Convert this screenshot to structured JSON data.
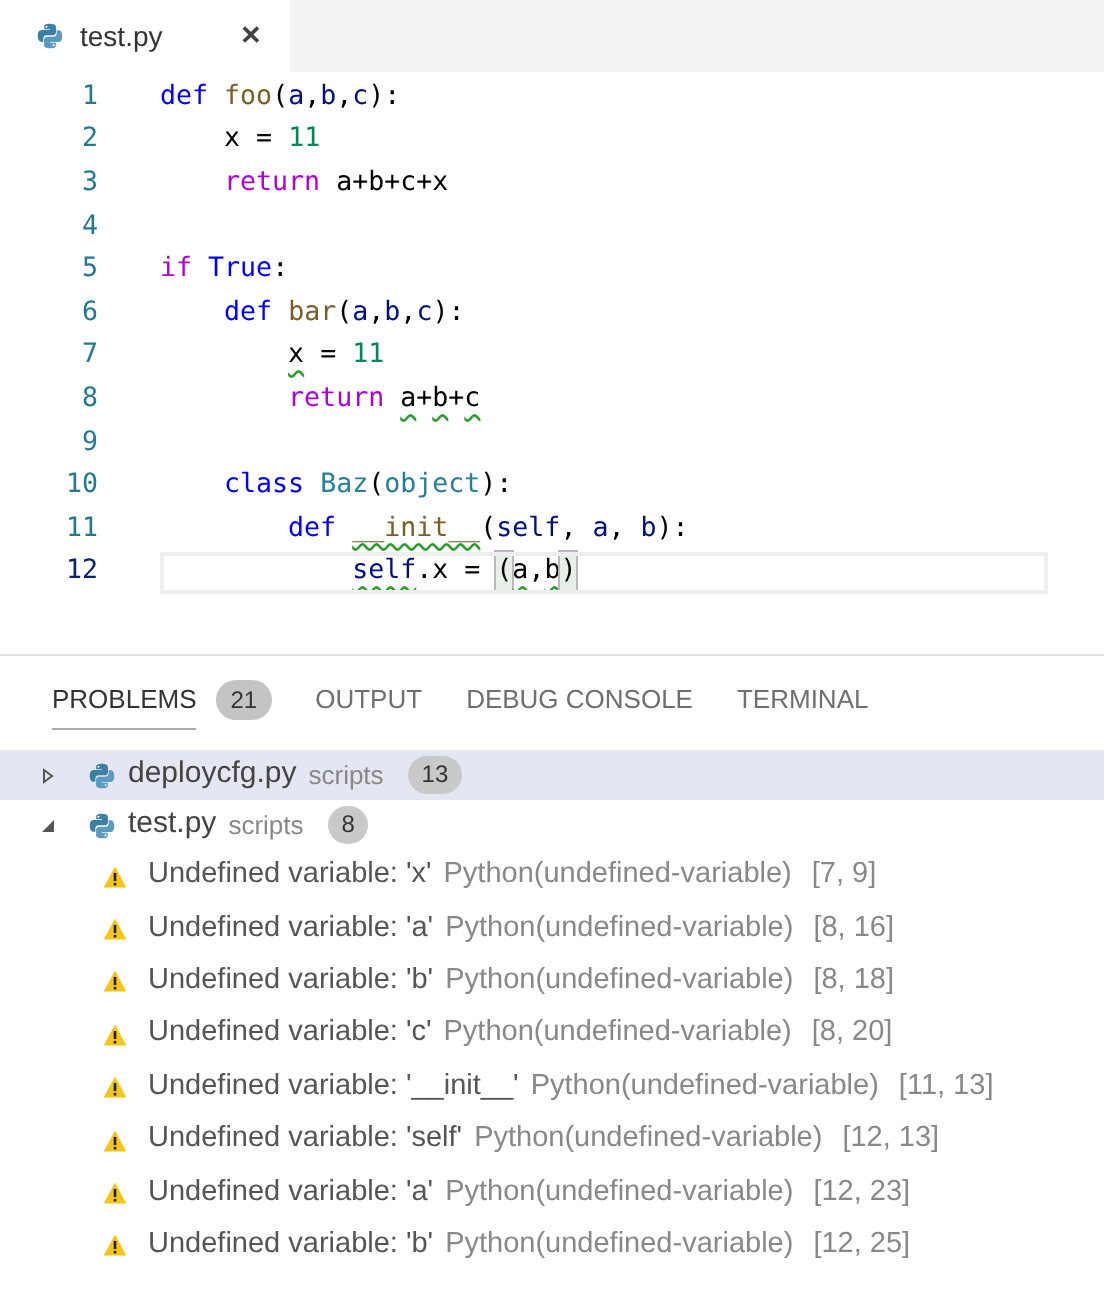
{
  "editor_tabs": [
    {
      "label": "test.py",
      "selected": true,
      "close": "✕"
    }
  ],
  "code_lines": [
    {
      "number": "1",
      "current": false,
      "tokens": [
        {
          "t": "def ",
          "kind": "kw",
          "squiggle": false
        },
        {
          "t": "foo",
          "kind": "fn",
          "squiggle": false
        },
        {
          "t": "(",
          "kind": "plain",
          "squiggle": false
        },
        {
          "t": "a",
          "kind": "param",
          "squiggle": false
        },
        {
          "t": ",",
          "kind": "plain",
          "squiggle": false
        },
        {
          "t": "b",
          "kind": "param",
          "squiggle": false
        },
        {
          "t": ",",
          "kind": "plain",
          "squiggle": false
        },
        {
          "t": "c",
          "kind": "param",
          "squiggle": false
        },
        {
          "t": "):",
          "kind": "plain",
          "squiggle": false
        }
      ]
    },
    {
      "number": "2",
      "current": false,
      "tokens": [
        {
          "t": "    x = ",
          "kind": "plain",
          "squiggle": false
        },
        {
          "t": "11",
          "kind": "num",
          "squiggle": false
        }
      ]
    },
    {
      "number": "3",
      "current": false,
      "tokens": [
        {
          "t": "    return",
          "kind": "ctrl",
          "squiggle": false
        },
        {
          "t": " a+b+c+x",
          "kind": "plain",
          "squiggle": false
        }
      ]
    },
    {
      "number": "4",
      "current": false
    },
    {
      "number": "5",
      "current": false,
      "tokens": [
        {
          "t": "if ",
          "kind": "ctrl",
          "squiggle": false
        },
        {
          "t": "True",
          "kind": "kw",
          "squiggle": false
        },
        {
          "t": ":",
          "kind": "plain",
          "squiggle": false
        }
      ]
    },
    {
      "number": "6",
      "current": false,
      "tokens": [
        {
          "t": "    def ",
          "kind": "kw",
          "squiggle": false
        },
        {
          "t": "bar",
          "kind": "fn",
          "squiggle": false
        },
        {
          "t": "(",
          "kind": "plain",
          "squiggle": false
        },
        {
          "t": "a",
          "kind": "param",
          "squiggle": false
        },
        {
          "t": ",",
          "kind": "plain",
          "squiggle": false
        },
        {
          "t": "b",
          "kind": "param",
          "squiggle": false
        },
        {
          "t": ",",
          "kind": "plain",
          "squiggle": false
        },
        {
          "t": "c",
          "kind": "param",
          "squiggle": false
        },
        {
          "t": "):",
          "kind": "plain",
          "squiggle": false
        }
      ]
    },
    {
      "number": "7",
      "current": false,
      "tokens": [
        {
          "t": "        x",
          "kind": "plain",
          "squiggle": true
        },
        {
          "t": " = ",
          "kind": "plain",
          "squiggle": false
        },
        {
          "t": "11",
          "kind": "num",
          "squiggle": false
        }
      ]
    },
    {
      "number": "8",
      "current": false,
      "tokens": [
        {
          "t": "        return ",
          "kind": "ctrl",
          "squiggle": false
        },
        {
          "t": "a",
          "kind": "plain",
          "squiggle": true
        },
        {
          "t": "+",
          "kind": "plain",
          "squiggle": false
        },
        {
          "t": "b",
          "kind": "plain",
          "squiggle": true
        },
        {
          "t": "+",
          "kind": "plain",
          "squiggle": false
        },
        {
          "t": "c",
          "kind": "plain",
          "squiggle": true
        }
      ]
    },
    {
      "number": "9",
      "current": false
    },
    {
      "number": "10",
      "current": false,
      "tokens": [
        {
          "t": "    class ",
          "kind": "kw",
          "squiggle": false
        },
        {
          "t": "Baz",
          "kind": "cls",
          "squiggle": false
        },
        {
          "t": "(",
          "kind": "plain",
          "squiggle": false
        },
        {
          "t": "object",
          "kind": "cls",
          "squiggle": false
        },
        {
          "t": "):",
          "kind": "plain",
          "squiggle": false
        }
      ]
    },
    {
      "number": "11",
      "current": false,
      "tokens": [
        {
          "t": "        def ",
          "kind": "kw",
          "squiggle": false
        },
        {
          "t": "__init__",
          "kind": "fn",
          "squiggle": true
        },
        {
          "t": "(",
          "kind": "plain",
          "squiggle": false
        },
        {
          "t": "self",
          "kind": "param",
          "squiggle": false
        },
        {
          "t": ", ",
          "kind": "plain",
          "squiggle": false
        },
        {
          "t": "a",
          "kind": "param",
          "squiggle": false
        },
        {
          "t": ", ",
          "kind": "plain",
          "squiggle": false
        },
        {
          "t": "b",
          "kind": "param",
          "squiggle": false
        },
        {
          "t": "):",
          "kind": "plain",
          "squiggle": false
        }
      ]
    },
    {
      "number": "12",
      "current": true,
      "tokens": [
        {
          "t": "            self",
          "kind": "param",
          "squiggle": true
        },
        {
          "t": ".x = ",
          "kind": "plain",
          "squiggle": false
        },
        {
          "t": "(",
          "kind": "bracket",
          "squiggle": false
        },
        {
          "t": "a",
          "kind": "plain",
          "squiggle": true
        },
        {
          "t": ",",
          "kind": "plain",
          "squiggle": false
        },
        {
          "t": "b",
          "kind": "plain",
          "squiggle": true
        },
        {
          "t": ")",
          "kind": "bracket",
          "squiggle": false
        }
      ]
    }
  ],
  "panel_tabs": [
    {
      "label": "PROBLEMS",
      "count": "21",
      "selected": true
    },
    {
      "label": "OUTPUT",
      "selected": false
    },
    {
      "label": "DEBUG CONSOLE",
      "selected": false
    },
    {
      "label": "TERMINAL",
      "selected": false
    }
  ],
  "problem_files": [
    {
      "name": "deploycfg.py",
      "folder": "scripts",
      "count": "13",
      "expanded": false,
      "selected": true
    },
    {
      "name": "test.py",
      "folder": "scripts",
      "count": "8",
      "expanded": true,
      "selected": false,
      "problems": [
        {
          "message": "Undefined variable: 'x'",
          "source": "Python(undefined-variable)",
          "position": "[7, 9]"
        },
        {
          "message": "Undefined variable: 'a'",
          "source": "Python(undefined-variable)",
          "position": "[8, 16]"
        },
        {
          "message": "Undefined variable: 'b'",
          "source": "Python(undefined-variable)",
          "position": "[8, 18]"
        },
        {
          "message": "Undefined variable: 'c'",
          "source": "Python(undefined-variable)",
          "position": "[8, 20]"
        },
        {
          "message": "Undefined variable: '__init__'",
          "source": "Python(undefined-variable)",
          "position": "[11, 13]"
        },
        {
          "message": "Undefined variable: 'self'",
          "source": "Python(undefined-variable)",
          "position": "[12, 13]"
        },
        {
          "message": "Undefined variable: 'a'",
          "source": "Python(undefined-variable)",
          "position": "[12, 23]"
        },
        {
          "message": "Undefined variable: 'b'",
          "source": "Python(undefined-variable)",
          "position": "[12, 25]"
        }
      ]
    }
  ]
}
